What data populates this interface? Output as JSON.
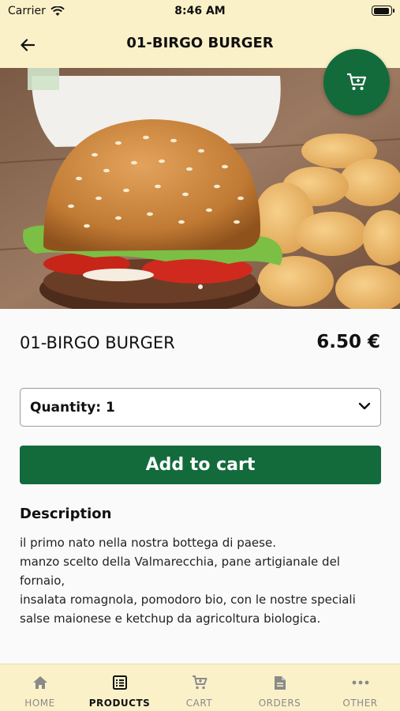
{
  "status_bar": {
    "carrier": "Carrier",
    "time": "8:46 AM"
  },
  "app_bar": {
    "title": "01-BIRGO BURGER"
  },
  "product": {
    "name": "01-BIRGO BURGER",
    "price": "6.50 €",
    "quantity_label": "Quantity: 1",
    "add_to_cart_label": "Add to cart",
    "description_title": "Description",
    "description_lines": [
      "il primo nato nella nostra bottega di paese.",
      "manzo scelto della Valmarecchia, pane artigianale del",
      "fornaio,",
      "insalata romagnola, pomodoro bio, con le nostre speciali",
      "salse maionese e ketchup da agricoltura biologica."
    ]
  },
  "tabs": [
    {
      "label": "HOME",
      "icon": "home-icon",
      "active": false
    },
    {
      "label": "PRODUCTS",
      "icon": "list-icon",
      "active": true
    },
    {
      "label": "CART",
      "icon": "cart-icon",
      "active": false
    },
    {
      "label": "ORDERS",
      "icon": "document-icon",
      "active": false
    },
    {
      "label": "OTHER",
      "icon": "more-icon",
      "active": false
    }
  ],
  "colors": {
    "accent": "#136b3c",
    "bar_background": "#fbf1c9"
  }
}
